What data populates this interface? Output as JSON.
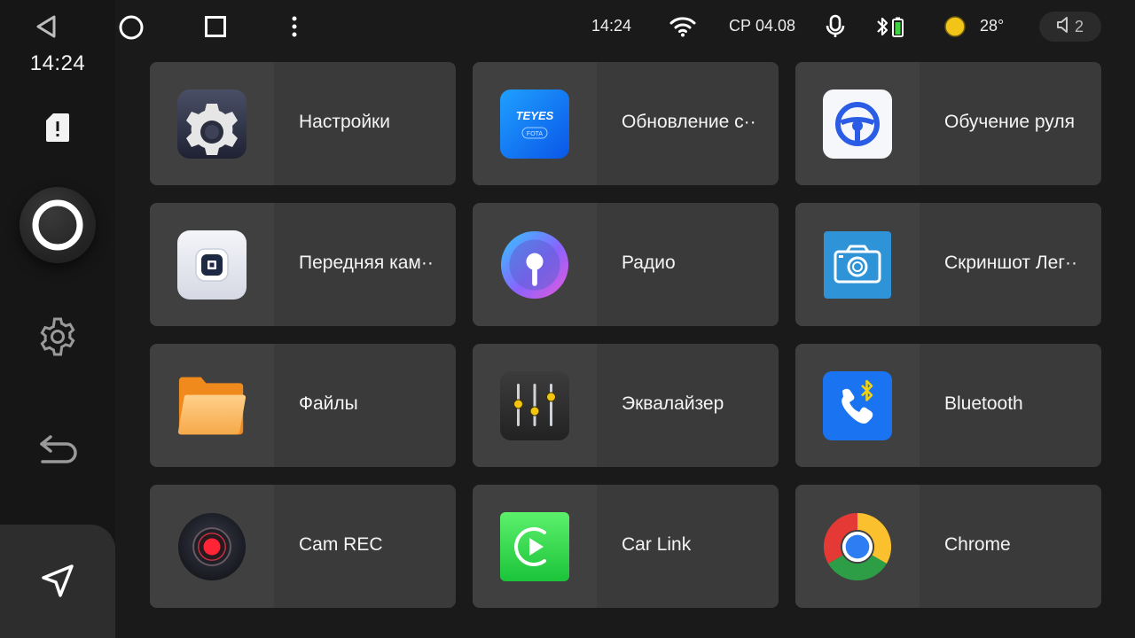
{
  "status_bar": {
    "time": "14:24",
    "date": "СР 04.08",
    "temperature": "28°",
    "volume_level": "2"
  },
  "rail": {
    "clock": "14:24"
  },
  "apps": [
    {
      "label": "Настройки",
      "icon": "settings-app-icon"
    },
    {
      "label": "Обновление с··",
      "icon": "teyes-fota-icon",
      "icon_text": "TEYES",
      "icon_subtext": "FOTA"
    },
    {
      "label": "Обучение руля",
      "icon": "steering-wheel-icon"
    },
    {
      "label": "Передняя кам··",
      "icon": "front-camera-icon"
    },
    {
      "label": "Радио",
      "icon": "radio-icon"
    },
    {
      "label": "Скриншот Лег··",
      "icon": "screenshot-camera-icon"
    },
    {
      "label": "Файлы",
      "icon": "folder-icon"
    },
    {
      "label": "Эквалайзер",
      "icon": "equalizer-icon"
    },
    {
      "label": "Bluetooth",
      "icon": "bluetooth-phone-icon"
    },
    {
      "label": "Cam REC",
      "icon": "cam-rec-icon"
    },
    {
      "label": "Car Link",
      "icon": "car-link-icon"
    },
    {
      "label": "Chrome",
      "icon": "chrome-icon"
    }
  ],
  "colors": {
    "background": "#1a1a1a",
    "tile": "#3a3a3a",
    "tile_icon_area": "#404040",
    "weather_sun": "#f2c418",
    "battery_green": "#3fd13f"
  }
}
